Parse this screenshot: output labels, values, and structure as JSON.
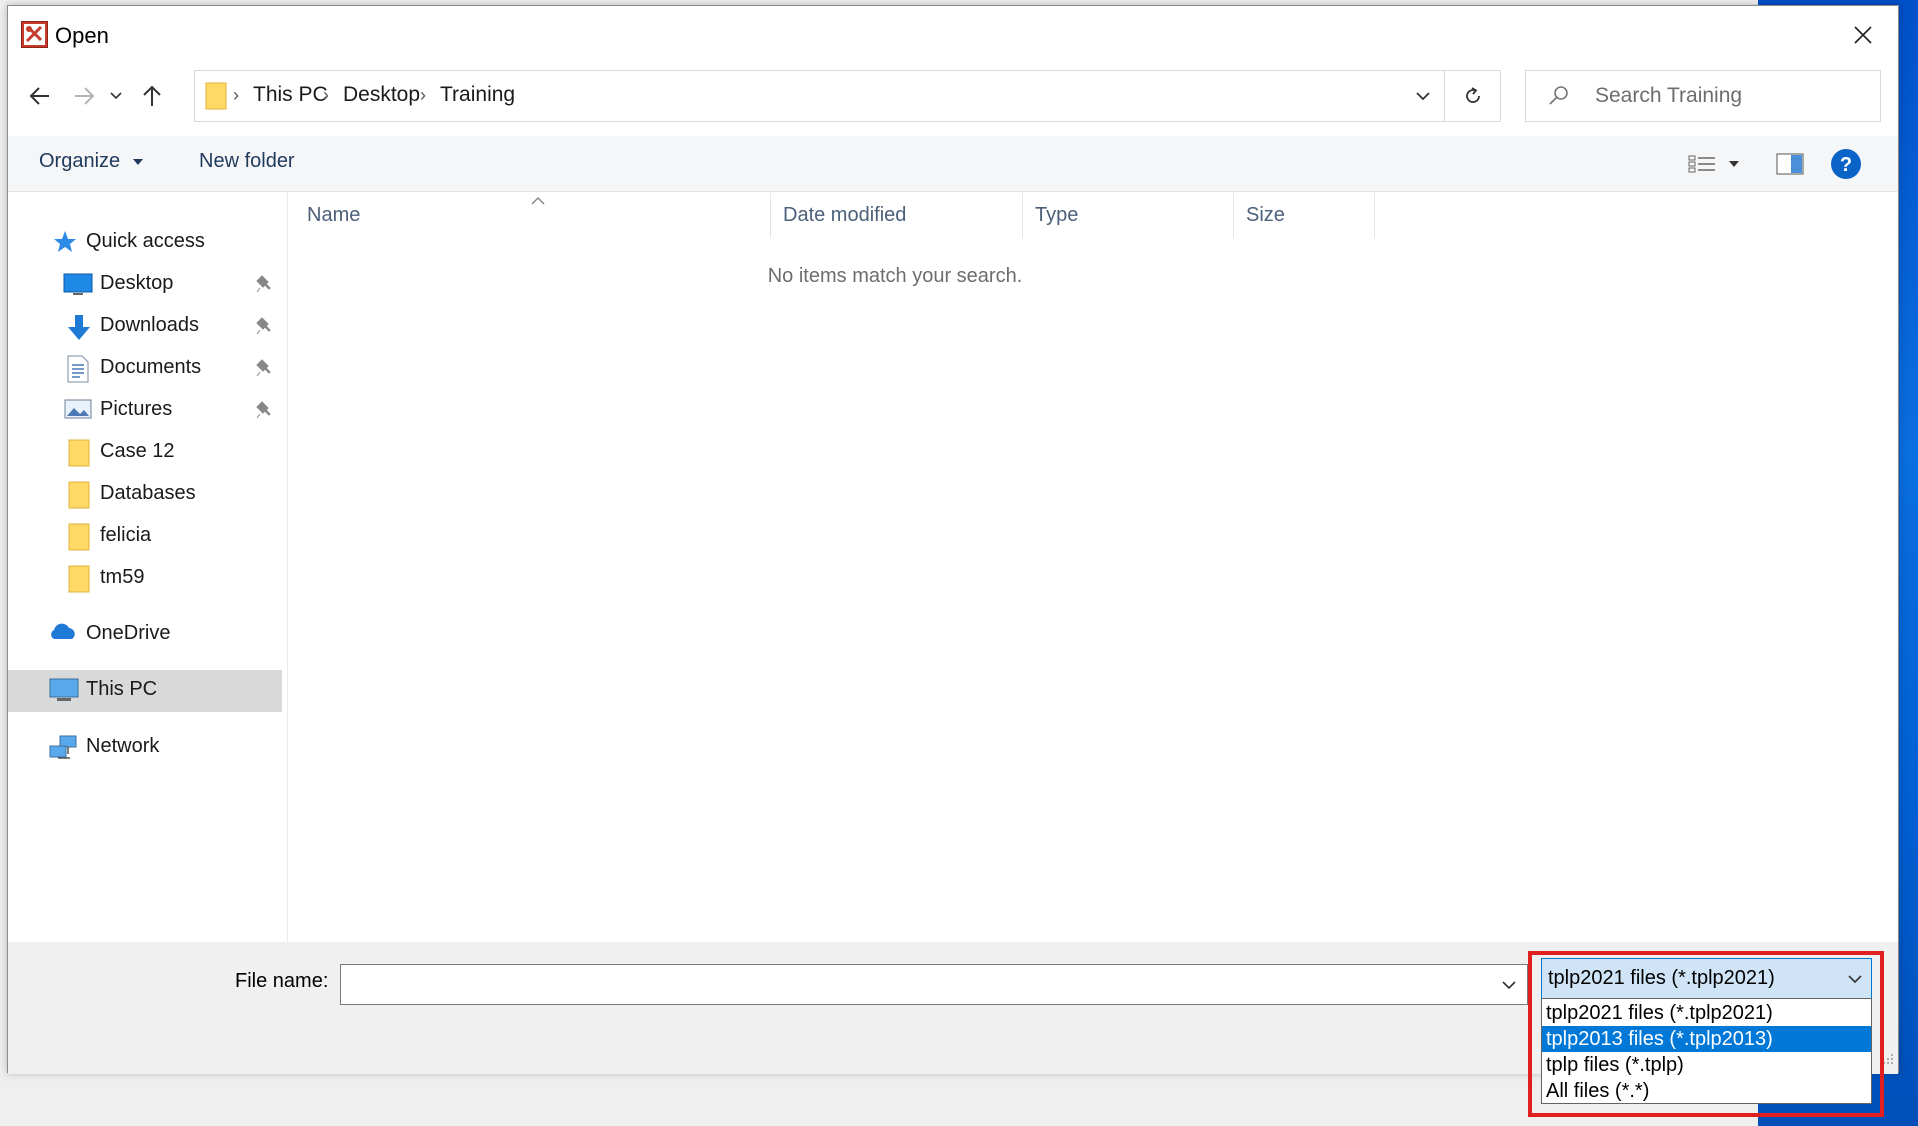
{
  "window": {
    "title": "Open"
  },
  "nav": {
    "breadcrumbs": [
      "This PC",
      "Desktop",
      "Training"
    ],
    "search_placeholder": "Search Training"
  },
  "toolbar": {
    "organize_label": "Organize",
    "new_folder_label": "New folder"
  },
  "sidebar": {
    "quick_access": "Quick access",
    "items": [
      {
        "label": "Desktop",
        "icon": "desktop-icon",
        "pinned": true
      },
      {
        "label": "Downloads",
        "icon": "downloads-icon",
        "pinned": true
      },
      {
        "label": "Documents",
        "icon": "documents-icon",
        "pinned": true
      },
      {
        "label": "Pictures",
        "icon": "pictures-icon",
        "pinned": true
      },
      {
        "label": "Case 12",
        "icon": "folder-icon",
        "pinned": false
      },
      {
        "label": "Databases",
        "icon": "folder-icon",
        "pinned": false
      },
      {
        "label": "felicia",
        "icon": "folder-icon",
        "pinned": false
      },
      {
        "label": "tm59",
        "icon": "folder-icon",
        "pinned": false
      }
    ],
    "onedrive": "OneDrive",
    "this_pc": "This PC",
    "network": "Network",
    "selected": "This PC"
  },
  "content": {
    "columns": [
      "Name",
      "Date modified",
      "Type",
      "Size"
    ],
    "empty_message": "No items match your search."
  },
  "bottom": {
    "file_name_label": "File name:",
    "file_name_value": "",
    "file_type_selected": "tplp2021 files (*.tplp2021)",
    "file_type_options": [
      "tplp2021 files (*.tplp2021)",
      "tplp2013 files (*.tplp2013)",
      "tplp files (*.tplp)",
      "All files (*.*)"
    ],
    "highlighted_option": "tplp2013 files (*.tplp2013)"
  },
  "colors": {
    "accent": "#0078d7",
    "highlight_box": "#e02020",
    "selected_row": "#d9d9d9"
  }
}
